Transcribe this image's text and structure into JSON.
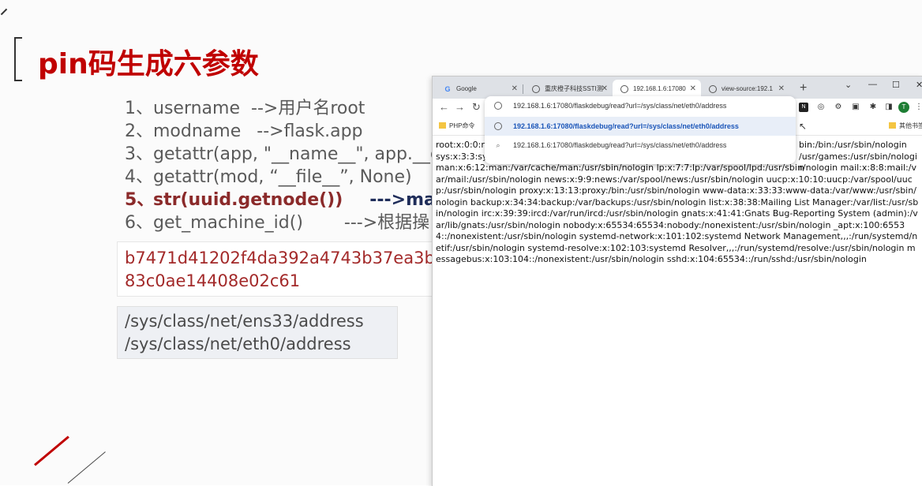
{
  "slide": {
    "title": "pin码生成六参数",
    "params": [
      {
        "num": "1、",
        "code": "username",
        "arrow": "-->",
        "note": "用户名root",
        "bold": false
      },
      {
        "num": "2、",
        "code": "modname",
        "arrow": "-->",
        "note": "flask.app",
        "bold": false
      },
      {
        "num": "3、",
        "code": "getattr(app, \"__name__\", app.__c",
        "arrow": "",
        "note": "",
        "bold": false
      },
      {
        "num": "4、",
        "code": "getattr(mod, “__file__”, None)",
        "arrow": "-",
        "note": "",
        "bold": false
      },
      {
        "num": "5、",
        "code": "str(uuid.getnode())",
        "arrow": "--->",
        "note": "mac地",
        "bold": true
      },
      {
        "num": "6、",
        "code": "get_machine_id()",
        "arrow": "--->",
        "note": "根据操",
        "bold": false
      }
    ],
    "hash_line1": "b7471d41202f4da392a4743b37ea3b",
    "hash_line2": "83c0ae14408e02c61",
    "path_line1": "/sys/class/net/ens33/address",
    "path_line2": "/sys/class/net/eth0/address"
  },
  "browser": {
    "tabs": [
      {
        "label": "Google",
        "icon": "google-icon",
        "active": false
      },
      {
        "label": "重庆橙子科技SSTI测",
        "icon": "globe-icon",
        "active": false
      },
      {
        "label": "192.168.1.6:17080",
        "icon": "globe-icon",
        "active": true
      },
      {
        "label": "view-source:192.1",
        "icon": "globe-icon",
        "active": false
      }
    ],
    "new_tab": "+",
    "address_value": "192.168.1.6:17080/flaskdebug/read?url=/sys/class/net/eth0/address",
    "suggestions": [
      {
        "text": "192.168.1.6:17080/flaskdebug/read?url=/sys/class/net/eth0/address",
        "icon": "globe-icon",
        "selected": true
      },
      {
        "text": "192.168.1.6:17080/flaskdebug/read?url=/sys/class/net/eth0/address",
        "icon": "search-icon",
        "selected": false
      }
    ],
    "bookmarks": [
      {
        "label": "PHP命令"
      },
      {
        "label": "其他书签"
      }
    ],
    "avatar_letter": "T",
    "page_text_top": "root:x:0:0:ro",
    "page_text_top_right": "bin:/bin:/usr/sbin/nologin",
    "page_text_sys": "sys:x:3:3:sys",
    "page_text_sys_right": "/usr/games:/usr/sbin/nologin",
    "page_text_body": "man:x:6:12:man:/var/cache/man:/usr/sbin/nologin lp:x:7:7:lp:/var/spool/lpd:/usr/sbin/nologin mail:x:8:8:mail:/var/mail:/usr/sbin/nologin news:x:9:9:news:/var/spool/news:/usr/sbin/nologin uucp:x:10:10:uucp:/var/spool/uucp:/usr/sbin/nologin proxy:x:13:13:proxy:/bin:/usr/sbin/nologin www-data:x:33:33:www-data:/var/www:/usr/sbin/nologin backup:x:34:34:backup:/var/backups:/usr/sbin/nologin list:x:38:38:Mailing List Manager:/var/list:/usr/sbin/nologin irc:x:39:39:ircd:/var/run/ircd:/usr/sbin/nologin gnats:x:41:41:Gnats Bug-Reporting System (admin):/var/lib/gnats:/usr/sbin/nologin nobody:x:65534:65534:nobody:/nonexistent:/usr/sbin/nologin _apt:x:100:65534::/nonexistent:/usr/sbin/nologin systemd-network:x:101:102:systemd Network Management,,,:/run/systemd/netif:/usr/sbin/nologin systemd-resolve:x:102:103:systemd Resolver,,,:/run/systemd/resolve:/usr/sbin/nologin messagebus:x:103:104::/nonexistent:/usr/sbin/nologin sshd:x:104:65534::/run/sshd:/usr/sbin/nologin"
  }
}
